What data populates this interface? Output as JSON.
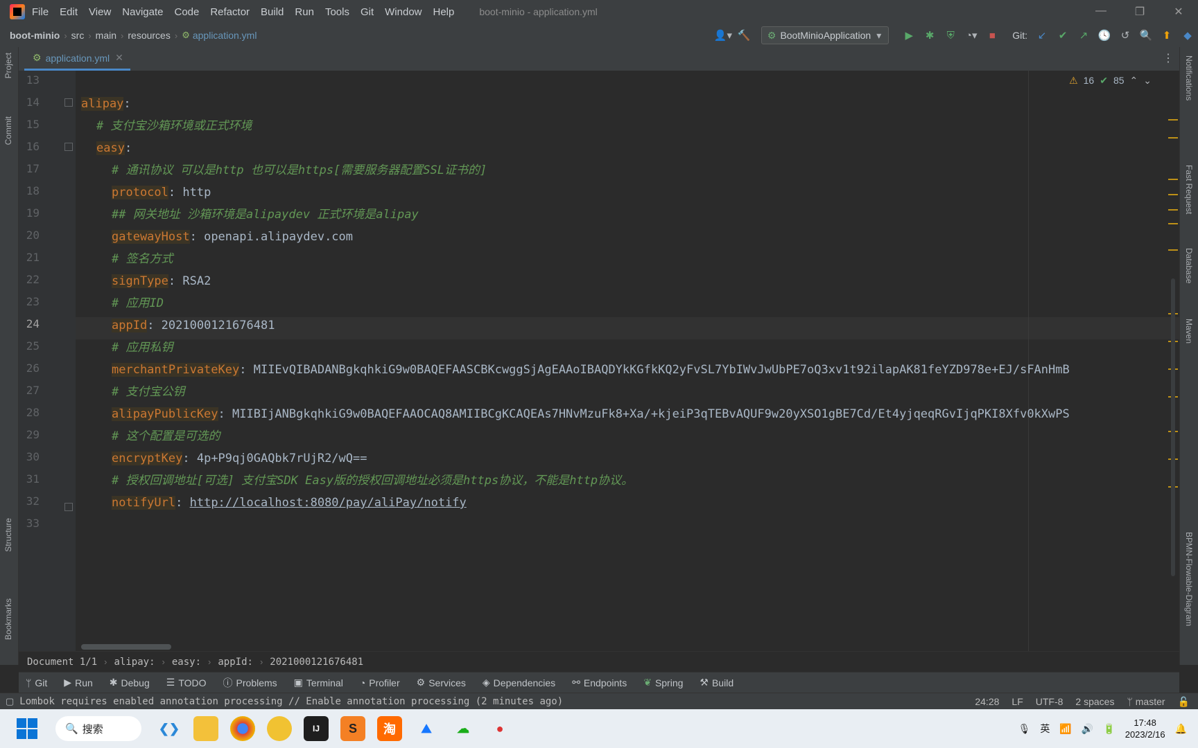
{
  "menu": {
    "items": [
      "File",
      "Edit",
      "View",
      "Navigate",
      "Code",
      "Refactor",
      "Build",
      "Run",
      "Tools",
      "Git",
      "Window",
      "Help"
    ],
    "window_title": "boot-minio - application.yml"
  },
  "nav": {
    "breadcrumbs": [
      "boot-minio",
      "src",
      "main",
      "resources"
    ],
    "file": "application.yml",
    "run_config": "BootMinioApplication",
    "git_label": "Git:"
  },
  "left_strip": {
    "project": "Project",
    "commit": "Commit",
    "structure": "Structure",
    "bookmarks": "Bookmarks"
  },
  "right_strip": {
    "notifications": "Notifications",
    "fast_request": "Fast Request",
    "database": "Database",
    "maven": "Maven",
    "bpmn": "BPMN-Flowable-Diagram"
  },
  "tab": {
    "label": "application.yml"
  },
  "inspection": {
    "warnings": "16",
    "ok": "85"
  },
  "editor": {
    "line_numbers": [
      "13",
      "14",
      "15",
      "16",
      "17",
      "18",
      "19",
      "20",
      "21",
      "22",
      "23",
      "24",
      "25",
      "26",
      "27",
      "28",
      "29",
      "30",
      "31",
      "32",
      "33"
    ],
    "current_line": "24",
    "lines": [
      {
        "key": "",
        "sep": "",
        "value": "",
        "comment": ""
      },
      {
        "key": "alipay",
        "sep": ":",
        "value": "",
        "comment": ""
      },
      {
        "key": "",
        "sep": "",
        "value": "",
        "comment": "# 支付宝沙箱环境或正式环境"
      },
      {
        "key": "easy",
        "sep": ":",
        "value": "",
        "comment": ""
      },
      {
        "key": "",
        "sep": "",
        "value": "",
        "comment": "# 通讯协议 可以是http 也可以是https[需要服务器配置SSL证书的]"
      },
      {
        "key": "protocol",
        "sep": ": ",
        "value": "http",
        "comment": ""
      },
      {
        "key": "",
        "sep": "",
        "value": "",
        "comment": "## 网关地址 沙箱环境是alipaydev 正式环境是alipay"
      },
      {
        "key": "gatewayHost",
        "sep": ": ",
        "value": "openapi.alipaydev.com",
        "comment": ""
      },
      {
        "key": "",
        "sep": "",
        "value": "",
        "comment": "# 签名方式"
      },
      {
        "key": "signType",
        "sep": ": ",
        "value": "RSA2",
        "comment": ""
      },
      {
        "key": "",
        "sep": "",
        "value": "",
        "comment": "# 应用ID"
      },
      {
        "key": "appId",
        "sep": ": ",
        "value": "2021000121676481",
        "comment": ""
      },
      {
        "key": "",
        "sep": "",
        "value": "",
        "comment": "# 应用私钥"
      },
      {
        "key": "merchantPrivateKey",
        "sep": ": ",
        "value": "MIIEvQIBADANBgkqhkiG9w0BAQEFAASCBKcwggSjAgEAAoIBAQDYkKGfkKQ2yFvSL7YbIWvJwUbPE7oQ3xv1t92ilapAK81feYZD978e+EJ/sFAnHmB",
        "comment": ""
      },
      {
        "key": "",
        "sep": "",
        "value": "",
        "comment": "# 支付宝公钥"
      },
      {
        "key": "alipayPublicKey",
        "sep": ": ",
        "value": "MIIBIjANBgkqhkiG9w0BAQEFAAOCAQ8AMIIBCgKCAQEAs7HNvMzuFk8+Xa/+kjeiP3qTEBvAQUF9w20yXSO1gBE7Cd/Et4yjqeqRGvIjqPKI8Xfv0kXwPS",
        "comment": ""
      },
      {
        "key": "",
        "sep": "",
        "value": "",
        "comment": "# 这个配置是可选的"
      },
      {
        "key": "encryptKey",
        "sep": ": ",
        "value": "4p+P9qj0GAQbk7rUjR2/wQ==",
        "comment": ""
      },
      {
        "key": "",
        "sep": "",
        "value": "",
        "comment": "# 授权回调地址[可选] 支付宝SDK Easy版的授权回调地址必须是https协议，不能是http协议。"
      },
      {
        "key": "notifyUrl",
        "sep": ": ",
        "value": "http://localhost:8080/pay/aliPay/notify",
        "comment": ""
      },
      {
        "key": "",
        "sep": "",
        "value": "",
        "comment": ""
      }
    ]
  },
  "structure_bar": [
    "Document 1/1",
    "alipay:",
    "easy:",
    "appId:",
    "2021000121676481"
  ],
  "tool_windows": [
    "Git",
    "Run",
    "Debug",
    "TODO",
    "Problems",
    "Terminal",
    "Profiler",
    "Services",
    "Dependencies",
    "Endpoints",
    "Spring",
    "Build"
  ],
  "status": {
    "message": "Lombok requires enabled annotation processing // Enable annotation processing (2 minutes ago)",
    "position": "24:28",
    "line_sep": "LF",
    "encoding": "UTF-8",
    "indent": "2 spaces",
    "branch": "master"
  },
  "taskbar": {
    "search": "搜索",
    "ime": "英",
    "time": "17:48",
    "date": "2023/2/16"
  }
}
